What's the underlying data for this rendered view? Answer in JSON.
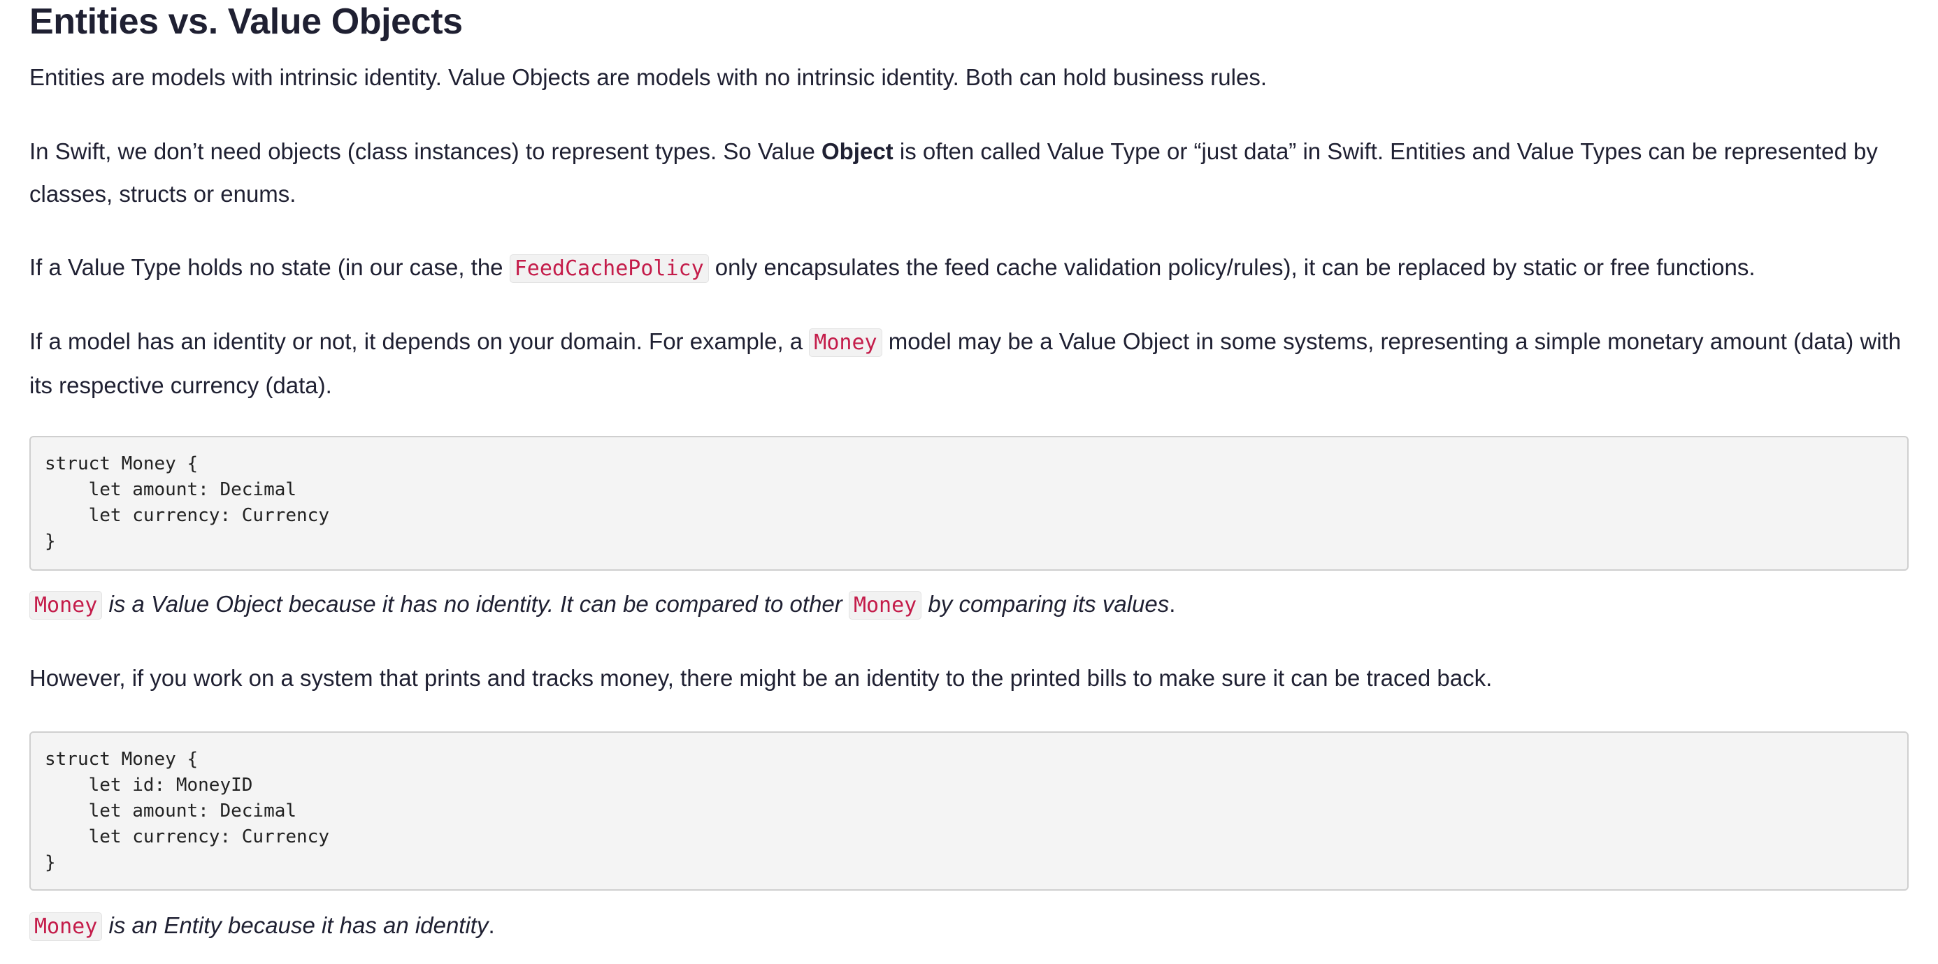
{
  "heading": "Entities vs. Value Objects",
  "p1": "Entities are models with intrinsic identity. Value Objects are models with no intrinsic identity. Both can hold business rules.",
  "p2": {
    "before": "In Swift, we don’t need objects (class instances) to represent types. So Value ",
    "bold": "Object",
    "after": " is often called Value Type or “just data” in Swift. Entities and Value Types can be represented by classes, structs or enums."
  },
  "p3": {
    "before": "If a Value Type holds no state (in our case, the ",
    "code": "FeedCachePolicy",
    "after": " only encapsulates the feed cache validation policy/rules), it can be replaced by static or free functions."
  },
  "p4": {
    "before": "If a model has an identity or not, it depends on your domain. For example, a ",
    "code": "Money",
    "after": " model may be a Value Object in some systems, representing a simple monetary amount (data) with its respective currency (data)."
  },
  "code1": [
    "struct Money {",
    "    let amount: Decimal",
    "    let currency: Currency",
    "}"
  ],
  "p5": {
    "code1": "Money",
    "text1": " is a Value Object because it has no identity. It can be compared to other ",
    "code2": "Money",
    "text2": " by comparing its values",
    "end": "."
  },
  "p6": "However, if you work on a system that prints and tracks money, there might be an identity to the printed bills to make sure it can be traced back.",
  "code2": [
    "struct Money {",
    "    let id: MoneyID",
    "    let amount: Decimal",
    "    let currency: Currency",
    "}"
  ],
  "p7": {
    "code": "Money",
    "text": " is an Entity because it has an identity",
    "end": "."
  }
}
